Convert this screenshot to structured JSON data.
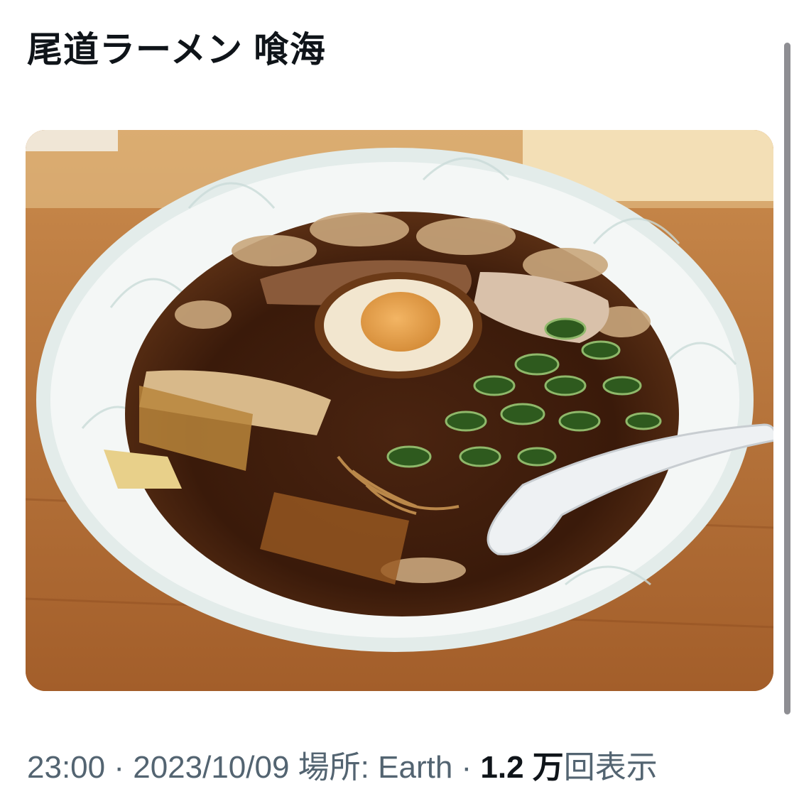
{
  "post": {
    "text": "尾道ラーメン 喰海",
    "image_alt": "ramen-bowl-photo"
  },
  "meta": {
    "time": "23:00",
    "separator1": " · ",
    "date": "2023/10/09",
    "location_label": " 場所: ",
    "location_value": "Earth",
    "separator2": " · ",
    "views_count": "1.2 万",
    "views_label": "回表示"
  },
  "colors": {
    "text_primary": "#0f1419",
    "text_secondary": "#536471",
    "scrollbar": "#8e8e93"
  }
}
